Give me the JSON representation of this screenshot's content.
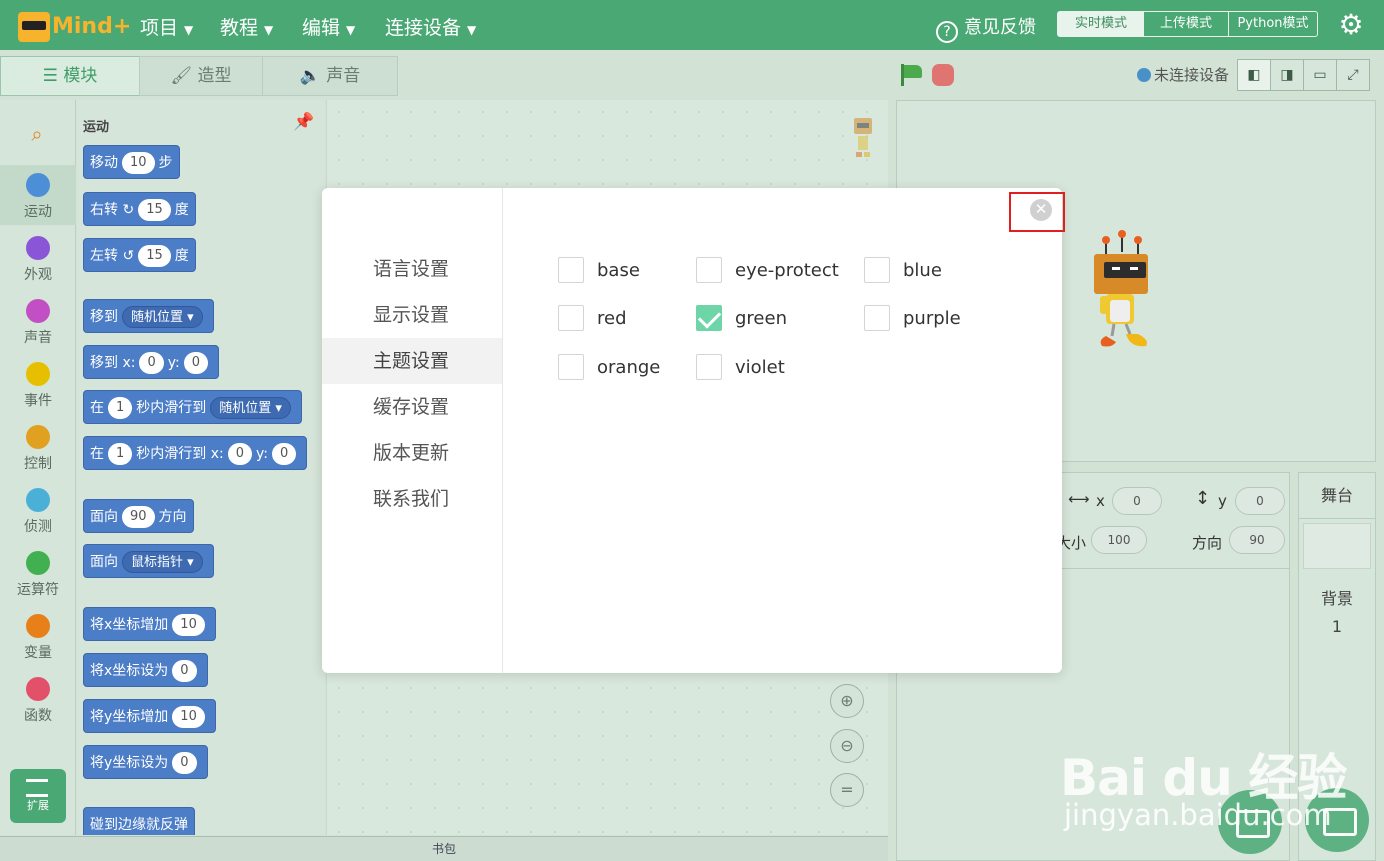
{
  "topbar": {
    "logo_text": "Mind+",
    "menus": [
      {
        "label": "项目"
      },
      {
        "label": "教程"
      },
      {
        "label": "编辑"
      },
      {
        "label": "连接设备"
      }
    ],
    "feedback": "意见反馈",
    "modes": {
      "live": "实时模式",
      "upload": "上传模式",
      "python": "Python模式"
    }
  },
  "editor_tabs": {
    "blocks": "模块",
    "costumes": "造型",
    "sounds": "声音"
  },
  "status": {
    "connection": "未连接设备"
  },
  "categories": [
    {
      "label": "运动",
      "color": "#4c8fd6"
    },
    {
      "label": "外观",
      "color": "#8a55d7"
    },
    {
      "label": "声音",
      "color": "#c24fc4"
    },
    {
      "label": "事件",
      "color": "#e6c000"
    },
    {
      "label": "控制",
      "color": "#e0a020"
    },
    {
      "label": "侦测",
      "color": "#4ab0d8"
    },
    {
      "label": "运算符",
      "color": "#40b050"
    },
    {
      "label": "变量",
      "color": "#e8801a"
    },
    {
      "label": "函数",
      "color": "#e2506a"
    }
  ],
  "extension_label": "扩展",
  "palette": {
    "title": "运动",
    "blocks": {
      "move": {
        "pre": "移动",
        "val": "10",
        "post": "步"
      },
      "turn_right": {
        "pre": "右转",
        "val": "15",
        "post": "度"
      },
      "turn_left": {
        "pre": "左转",
        "val": "15",
        "post": "度"
      },
      "goto": {
        "pre": "移到",
        "dd": "随机位置"
      },
      "goto_xy": {
        "pre": "移到 x:",
        "x": "0",
        "mid": "y:",
        "y": "0"
      },
      "glide": {
        "pre": "在",
        "val": "1",
        "mid": "秒内滑行到",
        "dd": "随机位置"
      },
      "glide_xy": {
        "pre": "在",
        "val": "1",
        "mid": "秒内滑行到 x:",
        "x": "0",
        "mid2": "y:",
        "y": "0"
      },
      "point_dir": {
        "pre": "面向",
        "val": "90",
        "post": "方向"
      },
      "point_towards": {
        "pre": "面向",
        "dd": "鼠标指针"
      },
      "change_x": {
        "pre": "将x坐标增加",
        "val": "10"
      },
      "set_x": {
        "pre": "将x坐标设为",
        "val": "0"
      },
      "change_y": {
        "pre": "将y坐标增加",
        "val": "10"
      },
      "set_y": {
        "pre": "将y坐标设为",
        "val": "0"
      },
      "bounce": {
        "pre": "碰到边缘就反弹"
      }
    }
  },
  "backpack_label": "书包",
  "sprite_info": {
    "x_label": "x",
    "x_value": "0",
    "y_label": "y",
    "y_value": "0",
    "size_label": "大小",
    "size_value": "100",
    "direction_label": "方向",
    "direction_value": "90"
  },
  "stage_panel": {
    "title": "舞台",
    "backdrop_label": "背景",
    "backdrop_count": "1"
  },
  "settings_modal": {
    "menu": [
      {
        "label": "语言设置",
        "selected": false
      },
      {
        "label": "显示设置",
        "selected": false
      },
      {
        "label": "主题设置",
        "selected": true
      },
      {
        "label": "缓存设置",
        "selected": false
      },
      {
        "label": "版本更新",
        "selected": false
      },
      {
        "label": "联系我们",
        "selected": false
      }
    ],
    "themes": [
      {
        "label": "base",
        "checked": false
      },
      {
        "label": "eye-protect",
        "checked": false
      },
      {
        "label": "blue",
        "checked": false
      },
      {
        "label": "red",
        "checked": false
      },
      {
        "label": "green",
        "checked": true
      },
      {
        "label": "purple",
        "checked": false
      },
      {
        "label": "orange",
        "checked": false
      },
      {
        "label": "violet",
        "checked": false
      }
    ],
    "accent_color": "#6dd5a8"
  },
  "watermark": {
    "logo": "Bai du 经验",
    "url": "jingyan.baidu.com"
  }
}
